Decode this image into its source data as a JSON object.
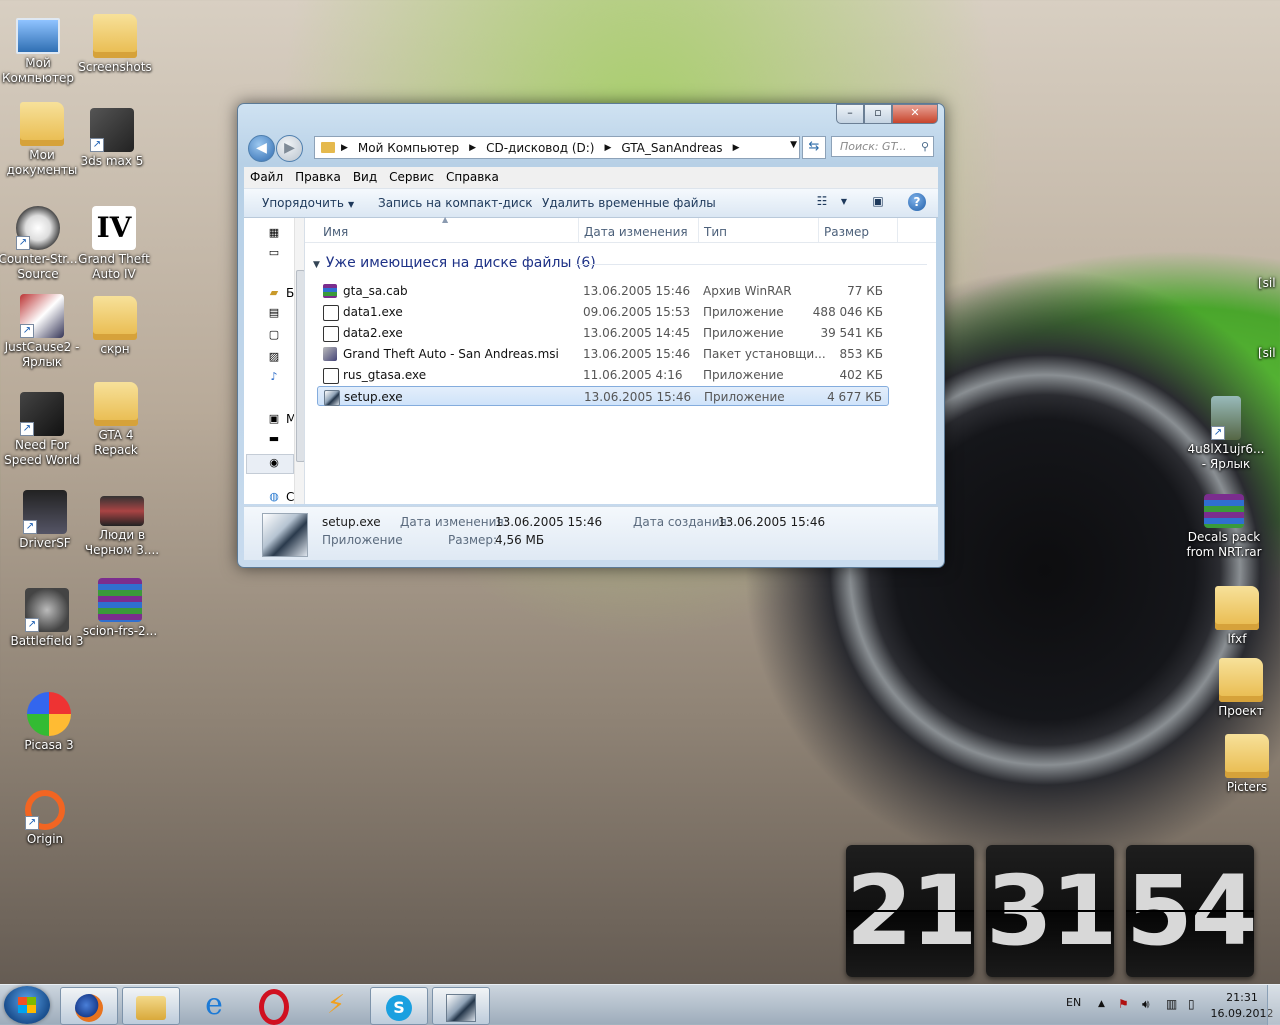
{
  "desktop": {
    "left_icons": [
      {
        "label": "Мой Компьютер",
        "kind": "computer-icon"
      },
      {
        "label": "Screenshots",
        "kind": "folder-icon"
      },
      {
        "label": "Мои документы",
        "kind": "folder-icon"
      },
      {
        "label": "3ds max 5",
        "kind": "3ds-max-icon"
      },
      {
        "label": "Counter-Str... Source",
        "kind": "counter-strike-icon"
      },
      {
        "label": "Grand Theft Auto IV",
        "kind": "gta-iv-icon"
      },
      {
        "label": "JustCause2 - Ярлык",
        "kind": "just-cause-icon"
      },
      {
        "label": "скрн",
        "kind": "folder-icon"
      },
      {
        "label": "Need For Speed World",
        "kind": "nfs-icon"
      },
      {
        "label": "GTA 4 Repack",
        "kind": "folder-icon"
      },
      {
        "label": "DriverSF",
        "kind": "driver-icon"
      },
      {
        "label": "Люди в Черном 3....",
        "kind": "video-icon"
      },
      {
        "label": "Battlefield 3",
        "kind": "battlefield-icon"
      },
      {
        "label": "scion-frs-2...",
        "kind": "winrar-icon"
      },
      {
        "label": "Picasa 3",
        "kind": "picasa-icon"
      },
      {
        "label": "Origin",
        "kind": "origin-icon"
      }
    ],
    "right_icons": [
      {
        "label": "[sil",
        "kind": "partial-icon"
      },
      {
        "label": "[sil",
        "kind": "partial-icon"
      },
      {
        "label": "4u8lX1ujr6... - Ярлык",
        "kind": "image-shortcut-icon"
      },
      {
        "label": "Decals pack from NRT.rar",
        "kind": "winrar-icon"
      },
      {
        "label": "lfxf",
        "kind": "folder-icon"
      },
      {
        "label": "Проект",
        "kind": "folder-icon"
      },
      {
        "label": "Picters",
        "kind": "folder-icon"
      }
    ]
  },
  "explorer": {
    "caption_buttons": {
      "minimize": "–",
      "maximize": "▫",
      "close": "✕"
    },
    "address": {
      "crumbs": [
        "Мой Компьютер",
        "CD-дисковод (D:)",
        "GTA_SanAndreas"
      ]
    },
    "search_placeholder": "Поиск: GT...",
    "menu": [
      "Файл",
      "Правка",
      "Вид",
      "Сервис",
      "Справка"
    ],
    "toolbar": {
      "organize": "Упорядочить",
      "burn": "Запись на компакт-диск",
      "delete_temp": "Удалить временные файлы"
    },
    "nav_letters": [
      "Б",
      "М",
      "С"
    ],
    "columns": [
      "Имя",
      "Дата изменения",
      "Тип",
      "Размер"
    ],
    "group_title": "Уже имеющиеся на диске файлы (6)",
    "files": [
      {
        "name": "gta_sa.cab",
        "date": "13.06.2005 15:46",
        "type": "Архив WinRAR",
        "size": "77 КБ",
        "icon": "winrar-icon"
      },
      {
        "name": "data1.exe",
        "date": "09.06.2005 15:53",
        "type": "Приложение",
        "size": "488 046 КБ",
        "icon": "7zip-icon"
      },
      {
        "name": "data2.exe",
        "date": "13.06.2005 14:45",
        "type": "Приложение",
        "size": "39 541 КБ",
        "icon": "7zip-icon"
      },
      {
        "name": "Grand Theft Auto - San Andreas.msi",
        "date": "13.06.2005 15:46",
        "type": "Пакет установщи...",
        "size": "853 КБ",
        "icon": "installer-icon"
      },
      {
        "name": "rus_gtasa.exe",
        "date": "11.06.2005 4:16",
        "type": "Приложение",
        "size": "402 КБ",
        "icon": "7zip-icon"
      },
      {
        "name": "setup.exe",
        "date": "13.06.2005 15:46",
        "type": "Приложение",
        "size": "4 677 КБ",
        "icon": "setup-icon"
      }
    ],
    "selected_index": 5,
    "details": {
      "name": "setup.exe",
      "type": "Приложение",
      "modified_label": "Дата изменения:",
      "modified_value": "13.06.2005 15:46",
      "created_label": "Дата создания:",
      "created_value": "13.06.2005 15:46",
      "size_label": "Размер:",
      "size_value": "4,56 МБ"
    }
  },
  "clock": {
    "hours": "21",
    "minutes": "31",
    "seconds": "54"
  },
  "taskbar": {
    "apps": [
      "firefox-icon",
      "explorer-icon",
      "ie-icon",
      "opera-icon",
      "winamp-icon",
      "skype-icon",
      "setup-icon"
    ],
    "language": "EN",
    "time": "21:31",
    "date": "16.09.2012"
  },
  "colors": {
    "accent": "#1e3287",
    "selection": "#cfe3fa"
  }
}
